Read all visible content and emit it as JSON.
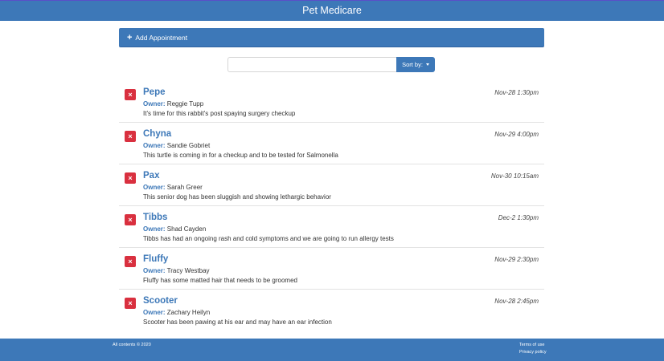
{
  "header": {
    "title": "Pet Medicare"
  },
  "add_bar": {
    "plus": "+",
    "label": "Add Appointment"
  },
  "search": {
    "value": "",
    "placeholder": ""
  },
  "sort": {
    "label": "Sort by:"
  },
  "delete_glyph": "×",
  "owner_label": "Owner:",
  "appointments": [
    {
      "pet": "Pepe",
      "owner": "Reggie Tupp",
      "date": "Nov-28 1:30pm",
      "note": "It's time for this rabbit's post spaying surgery checkup"
    },
    {
      "pet": "Chyna",
      "owner": "Sandie Gobriet",
      "date": "Nov-29 4:00pm",
      "note": "This turtle is coming in for a checkup and to be tested for Salmonella"
    },
    {
      "pet": "Pax",
      "owner": "Sarah Greer",
      "date": "Nov-30 10:15am",
      "note": "This senior dog has been sluggish and showing lethargic behavior"
    },
    {
      "pet": "Tibbs",
      "owner": "Shad Cayden",
      "date": "Dec-2 1:30pm",
      "note": "Tibbs has had an ongoing rash and cold symptoms and we are going to run allergy tests"
    },
    {
      "pet": "Fluffy",
      "owner": "Tracy Westbay",
      "date": "Nov-29 2:30pm",
      "note": "Fluffy has some matted hair that needs to be groomed"
    },
    {
      "pet": "Scooter",
      "owner": "Zachary Heilyn",
      "date": "Nov-28 2:45pm",
      "note": "Scooter has been pawing at his ear and may have an ear infection"
    }
  ],
  "footer": {
    "copyright": "All contents © 2020",
    "terms": "Terms of use",
    "privacy": "Privacy policy"
  },
  "colors": {
    "primary": "#3d78b8",
    "danger": "#d9303f"
  }
}
